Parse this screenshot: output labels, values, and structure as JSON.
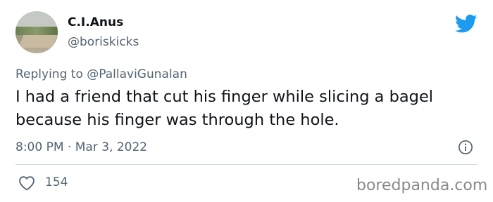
{
  "author": {
    "display_name": "C.I.Anus",
    "handle": "@boriskicks"
  },
  "reply": {
    "prefix": "Replying to",
    "mention": "@PallaviGunalan"
  },
  "tweet": {
    "text": "I had a friend that cut his finger while slicing a bagel because his finger was through the hole.",
    "time": "8:00 PM",
    "separator": "·",
    "date": "Mar 3, 2022"
  },
  "engagement": {
    "likes": "154"
  },
  "watermark": "boredpanda.com",
  "icons": {
    "brand": "twitter-bird-icon",
    "info": "info-icon",
    "like": "heart-icon"
  },
  "colors": {
    "twitter_blue": "#1d9bf0",
    "text": "#0f1419",
    "secondary": "#536471"
  }
}
